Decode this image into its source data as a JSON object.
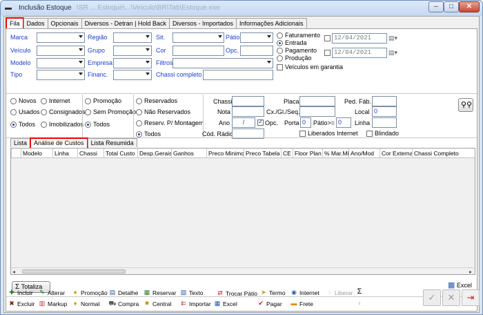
{
  "window": {
    "title": "Inclusão Estoque",
    "title_ghost": "\\SR  ...  Estoque\\...\\Veículo\\BR\\Tab\\Estoque.exe",
    "min_label": "–",
    "max_label": "□",
    "close_label": "✕"
  },
  "tabs": [
    "Fila",
    "Dados",
    "Opcionais",
    "Diversos - Detran | Hold Back",
    "Diversos - Importados",
    "Informações Adicionais"
  ],
  "filters": {
    "marca": "Marca",
    "veiculo": "Veículo",
    "modelo": "Modelo",
    "tipo": "Tipo",
    "regiao": "Região",
    "grupo": "Grupo",
    "empresa": "Empresa",
    "financ": "Financ.",
    "sit": "Sit.",
    "cor": "Cor",
    "filtros": "Filtros",
    "chassi_completo": "Chassi completo",
    "patio": "Pátio",
    "opc": "Opc."
  },
  "date_options": {
    "faturamento": "Faturamento",
    "entrada": "Entrada",
    "pagamento": "Pagamento",
    "producao": "Produção",
    "date1": "12/04/2021",
    "date2": "12/04/2021",
    "garantia": "Veículos em garantia"
  },
  "status_radios": {
    "novos": "Novos",
    "internet": "Internet",
    "usados": "Usados",
    "consignados": "Consignados",
    "todos": "Todos",
    "imobilizados": "Imobilizados"
  },
  "promo_radios": {
    "promocao": "Promoção",
    "sem_promocao": "Sem Promoção",
    "todos": "Todos"
  },
  "reserva_radios": {
    "reservados": "Reservados",
    "nao_reservados": "Não Reservados",
    "reserv_montagem": "Reserv. P/ Montagem",
    "todos": "Todos"
  },
  "search": {
    "chassi": "Chassi",
    "placa": "Placa",
    "ped_fab": "Ped. Fáb.",
    "nota": "Nota",
    "cx_gl_seq": "Cx./Gl./Seq.",
    "local": "Local",
    "local_value": "0",
    "ano": "Ano",
    "ano_value": "/",
    "opc": "Opc.",
    "porta": "Porta",
    "porta_value": "0",
    "patio_ge": "Pátio>=",
    "patio_ge_value": "0",
    "linha": "Linha",
    "cod_radio": "Cód. Rádio",
    "liberados_internet": "Liberados Internet",
    "blindado": "Blindado"
  },
  "subtabs": [
    "Lista",
    "Análise de Custos",
    "Lista Resumida"
  ],
  "grid_columns": [
    "Modelo",
    "Linha",
    "Chassi",
    "Total Custo",
    "Desp.Gerais",
    "Ganhos",
    "Preco Minimo",
    "Preco Tabela",
    "CE",
    "Floor Plan",
    "% Mar.Mi",
    "Ano/Mod",
    "Cor Externa",
    "Chassi Completo"
  ],
  "buttons": {
    "totaliza": "Totaliza",
    "excel": "Excel"
  },
  "toolbar_row1": [
    {
      "icon": "✚",
      "label": "Incluir",
      "color": "#1a6e1a"
    },
    {
      "icon": "✎",
      "label": "Alterar",
      "color": "#1a6e1a"
    },
    {
      "icon": "♦",
      "label": "Promoção",
      "color": "#c49a00"
    },
    {
      "icon": "▤",
      "label": "Detalhe",
      "color": "#2a5aa8"
    },
    {
      "icon": "▦",
      "label": "Reservar",
      "color": "#2a7a2a"
    },
    {
      "icon": "▧",
      "label": "Texto",
      "color": "#2a5aa8"
    },
    {
      "icon": "⇄",
      "label": "Trocar Pátio",
      "color": "#c03030"
    },
    {
      "icon": "➤",
      "label": "Termo",
      "color": "#c49a00"
    },
    {
      "icon": "◉",
      "label": "Internet",
      "color": "#2a5aa8"
    },
    {
      "icon": "◌",
      "label": "Liberar",
      "color": "#9a9a9a"
    },
    {
      "icon": "Σ",
      "label": "",
      "color": "#000"
    }
  ],
  "toolbar_row2": [
    {
      "icon": "✖",
      "label": "Excluir",
      "color": "#7a1a1a"
    },
    {
      "icon": "▥",
      "label": "Markup",
      "color": "#c03030"
    },
    {
      "icon": "♦",
      "label": "Normal",
      "color": "#c49a00"
    },
    {
      "icon": "⛟",
      "label": "Compra",
      "color": "#555"
    },
    {
      "icon": "✸",
      "label": "Central",
      "color": "#c49a00"
    },
    {
      "icon": "⇇",
      "label": "Importar",
      "color": "#c03030"
    },
    {
      "icon": "▦",
      "label": "Excel",
      "color": "#2a5aa8"
    },
    {
      "icon": "✔",
      "label": "Pagar",
      "color": "#d01010"
    },
    {
      "icon": "▬",
      "label": "Frete",
      "color": "#e08a00"
    },
    {
      "icon": "♀",
      "label": "",
      "color": "#c49a00"
    }
  ],
  "action_buttons": {
    "confirm": "✓",
    "cancel": "✕",
    "exit": "⇥"
  }
}
